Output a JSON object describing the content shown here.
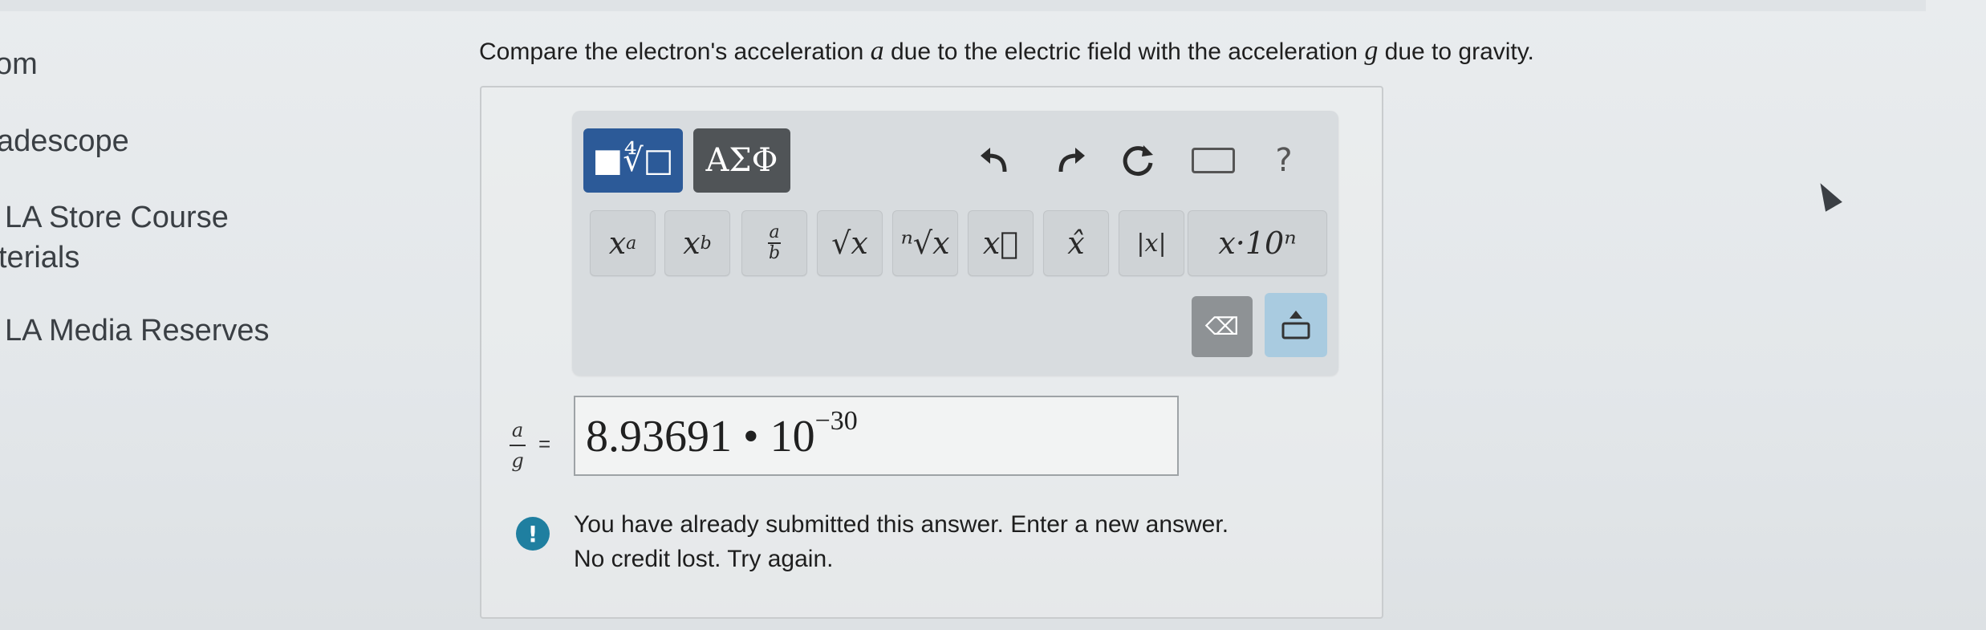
{
  "sidebar": {
    "items": [
      {
        "label": "om"
      },
      {
        "label": "adescope"
      },
      {
        "label": "LA Store Course"
      },
      {
        "label": "terials"
      },
      {
        "label": "LA Media Reserves"
      }
    ]
  },
  "question": {
    "prefix": "Compare the electron's acceleration ",
    "var_a": "a",
    "middle": " due to the electric field with the acceleration ",
    "var_g": "g",
    "suffix": " due to gravity."
  },
  "toolbar": {
    "tab_math": "■∜□",
    "tab_greek": "ΑΣΦ",
    "undo_icon": "undo-icon",
    "redo_icon": "redo-icon",
    "reset_icon": "reset-icon",
    "keyboard_icon": "keyboard-icon",
    "help_label": "?",
    "buttons": [
      {
        "base": "x",
        "sup": "a"
      },
      {
        "base": "x",
        "sub": "b"
      },
      {
        "num": "a",
        "den": "b"
      },
      {
        "label": "√x"
      },
      {
        "label": "ⁿ√x"
      },
      {
        "label": "x⃗"
      },
      {
        "label": "x̂"
      },
      {
        "label": "|x|"
      },
      {
        "label": "x·10ⁿ"
      }
    ],
    "delete_label": "⌫"
  },
  "answer": {
    "lhs_num": "a",
    "lhs_den": "g",
    "equals": "=",
    "mantissa": "8.93691 • 10",
    "exponent": "−30"
  },
  "feedback": {
    "icon_label": "!",
    "line1": "You have already submitted this answer. Enter a new answer.",
    "line2": "No credit lost. Try again."
  }
}
